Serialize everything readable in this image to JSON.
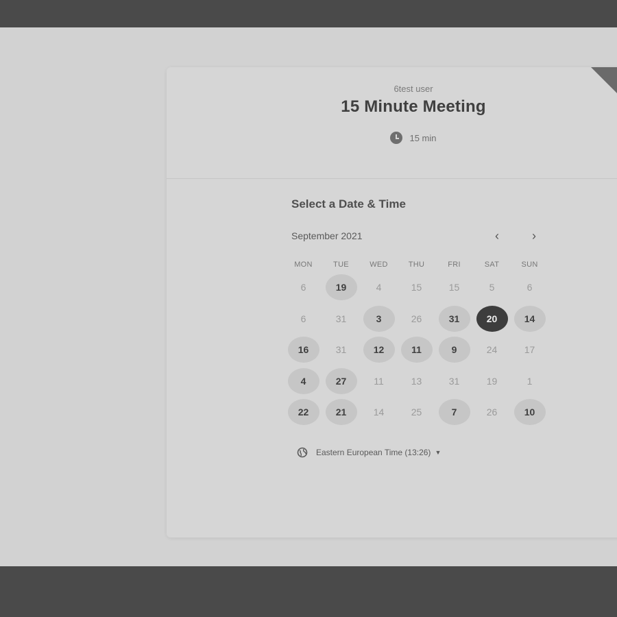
{
  "header": {
    "owner": "6test user",
    "event_title": "15 Minute Meeting",
    "duration": "15 min"
  },
  "calendar": {
    "section_title": "Select a Date & Time",
    "month_label": "September 2021",
    "prev_icon": "chevron-left-icon",
    "next_icon": "chevron-right-icon",
    "weekdays": [
      "MON",
      "TUE",
      "WED",
      "THU",
      "FRI",
      "SAT",
      "SUN"
    ],
    "days": [
      {
        "label": "6",
        "state": "unavailable"
      },
      {
        "label": "19",
        "state": "available"
      },
      {
        "label": "4",
        "state": "unavailable"
      },
      {
        "label": "15",
        "state": "unavailable"
      },
      {
        "label": "15",
        "state": "unavailable"
      },
      {
        "label": "5",
        "state": "unavailable"
      },
      {
        "label": "6",
        "state": "unavailable"
      },
      {
        "label": "6",
        "state": "unavailable"
      },
      {
        "label": "31",
        "state": "unavailable"
      },
      {
        "label": "3",
        "state": "available"
      },
      {
        "label": "26",
        "state": "unavailable"
      },
      {
        "label": "31",
        "state": "available"
      },
      {
        "label": "20",
        "state": "selected"
      },
      {
        "label": "14",
        "state": "available"
      },
      {
        "label": "16",
        "state": "available"
      },
      {
        "label": "31",
        "state": "unavailable"
      },
      {
        "label": "12",
        "state": "available"
      },
      {
        "label": "11",
        "state": "available"
      },
      {
        "label": "9",
        "state": "available"
      },
      {
        "label": "24",
        "state": "unavailable"
      },
      {
        "label": "17",
        "state": "unavailable"
      },
      {
        "label": "4",
        "state": "available"
      },
      {
        "label": "27",
        "state": "available"
      },
      {
        "label": "11",
        "state": "unavailable"
      },
      {
        "label": "13",
        "state": "unavailable"
      },
      {
        "label": "31",
        "state": "unavailable"
      },
      {
        "label": "19",
        "state": "unavailable"
      },
      {
        "label": "1",
        "state": "unavailable"
      },
      {
        "label": "22",
        "state": "available"
      },
      {
        "label": "21",
        "state": "available"
      },
      {
        "label": "14",
        "state": "unavailable"
      },
      {
        "label": "25",
        "state": "unavailable"
      },
      {
        "label": "7",
        "state": "available"
      },
      {
        "label": "26",
        "state": "unavailable"
      },
      {
        "label": "10",
        "state": "available"
      }
    ]
  },
  "timezone": {
    "label": "Eastern European Time (13:26)",
    "icon": "globe-icon"
  }
}
